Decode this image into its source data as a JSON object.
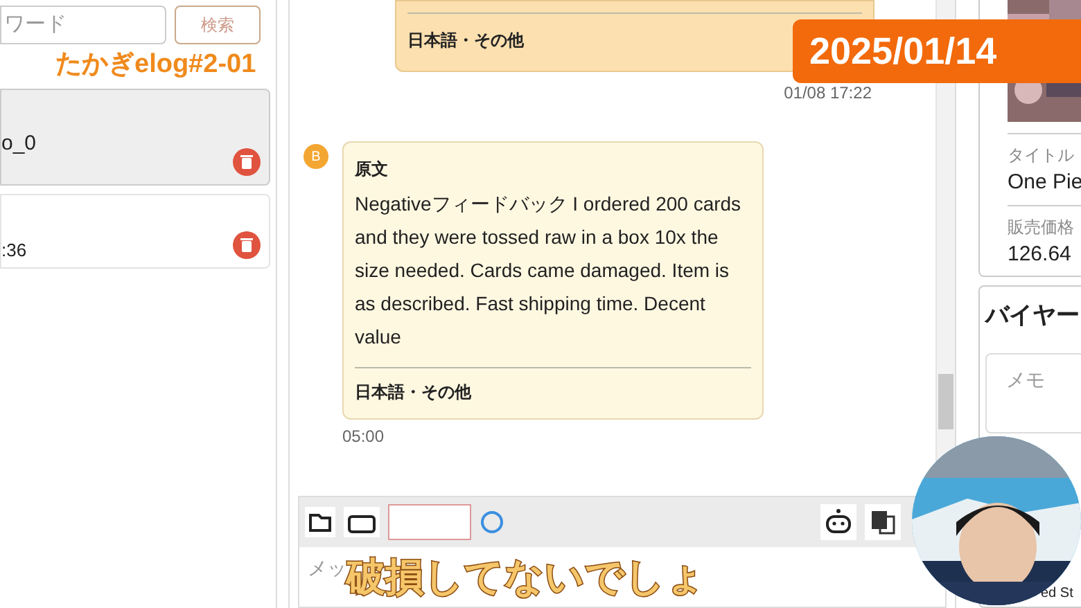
{
  "sidebar": {
    "search": {
      "placeholder": "ワード"
    },
    "search_button": "検索",
    "items": [
      {
        "label": "o_0",
        "selected": true
      },
      {
        "label": ":36",
        "selected": false
      }
    ]
  },
  "chat": {
    "messages": [
      {
        "kind": "sent",
        "language": "日本語・その他",
        "time": "01/08 17:22"
      },
      {
        "kind": "received",
        "avatar": "B",
        "heading": "原文",
        "text": "Negativeフィードバック I ordered 200 cards and they were tossed raw in a box 10x the size needed. Cards came damaged. Item is as described. Fast shipping time. Decent value",
        "language": "日本語・その他",
        "time": "05:00"
      }
    ],
    "composer": {
      "placeholder": "メッ"
    }
  },
  "detail": {
    "fields": [
      {
        "label": "タイトル",
        "value": "One Pie"
      },
      {
        "label": "販売価格",
        "value": "126.64"
      }
    ],
    "buyer_title": "バイヤー",
    "memo_placeholder": "メモ",
    "footer": "ed St"
  },
  "overlays": {
    "episode": "たかぎelog#2-01",
    "date": "2025/01/14",
    "caption": "破損してないでしょ"
  }
}
